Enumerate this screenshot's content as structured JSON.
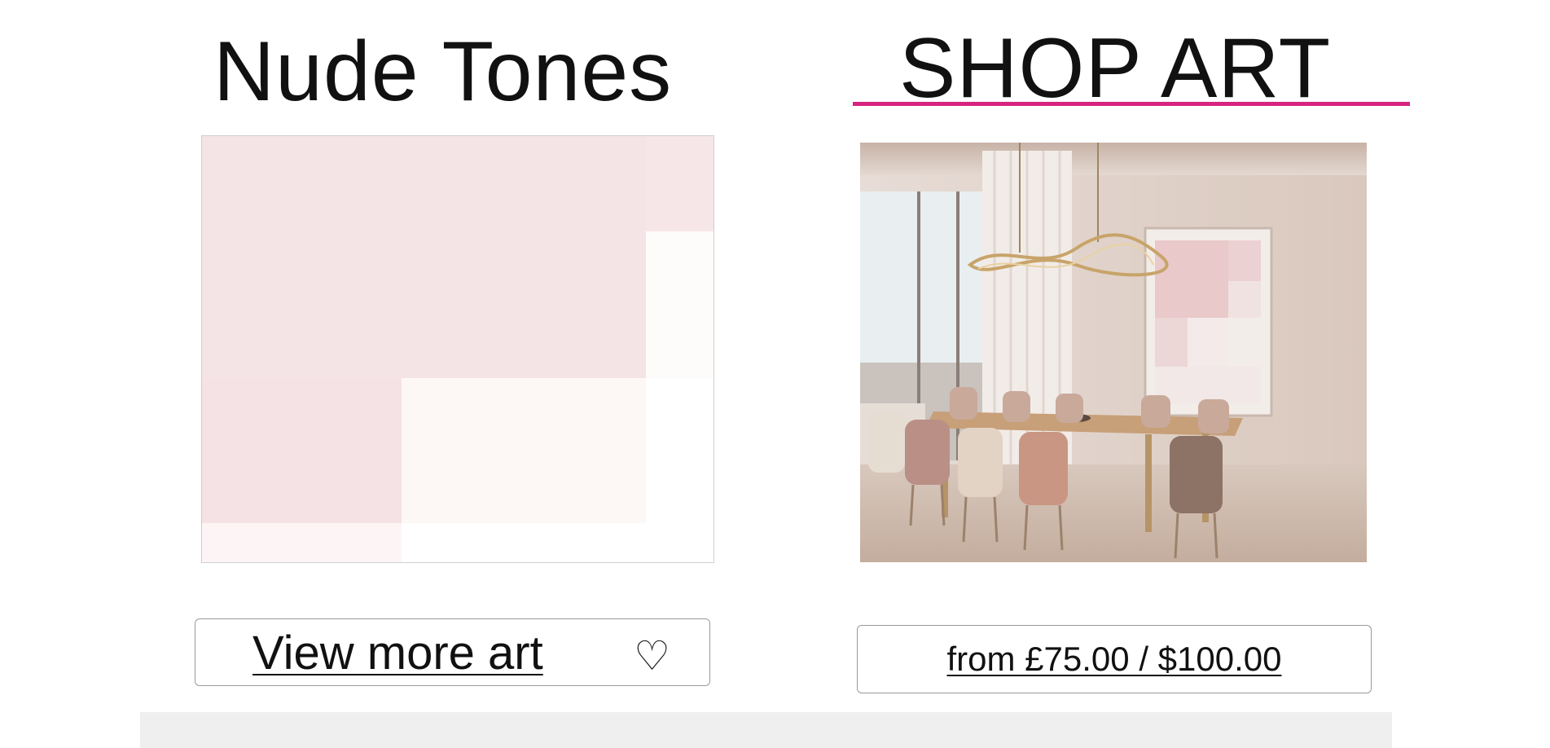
{
  "colors": {
    "accent": "#d6247f",
    "footer_bg": "#efefef",
    "artwork_pink_dark": "#f3e1e3",
    "artwork_pink_mid": "#f6e6e8",
    "artwork_pink_light": "#fdf7f7",
    "artwork_white": "#ffffff"
  },
  "left": {
    "title": "Nude Tones",
    "button_label": "View more art",
    "favorite_icon": "heart-outline-icon",
    "favorite_glyph": "♡"
  },
  "right": {
    "title": "SHOP ART",
    "price_label": "from £75.00 / $100.00"
  }
}
